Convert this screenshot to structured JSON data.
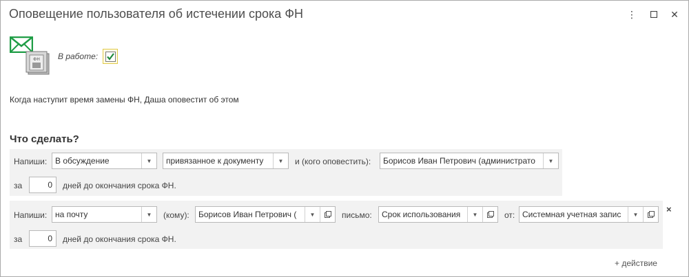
{
  "window": {
    "title": "Оповещение пользователя об истечении срока ФН",
    "menu_icon": "⋮",
    "maximize_icon": "☐",
    "close_icon": "✕"
  },
  "in_work": {
    "label": "В работе:",
    "checked": true
  },
  "info_text": "Когда наступит время замены ФН, Даша оповестит об этом",
  "section_title": "Что сделать?",
  "action1": {
    "write_label": "Напиши:",
    "write_value": "В обсуждение",
    "attached_value": "привязанное к документу",
    "notify_label": "и (кого оповестить):",
    "notify_value": "Борисов Иван Петрович (администрато",
    "za_label": "за",
    "days": "0",
    "days_label": "дней до окончания срока ФН."
  },
  "action2": {
    "write_label": "Напиши:",
    "write_value": "на почту",
    "to_label": "(кому):",
    "to_value": "Борисов Иван Петрович (",
    "letter_label": "письмо:",
    "letter_value": "Срок использования",
    "from_label": "от:",
    "from_value": "Системная учетная запис",
    "za_label": "за",
    "days": "0",
    "days_label": "дней до окончания срока ФН.",
    "remove_icon": "×"
  },
  "add_action_label": "+ действие",
  "colors": {
    "checkbox_highlight": "#e0c948",
    "check": "#1f8a3b",
    "envelope": "#1f9d46"
  }
}
